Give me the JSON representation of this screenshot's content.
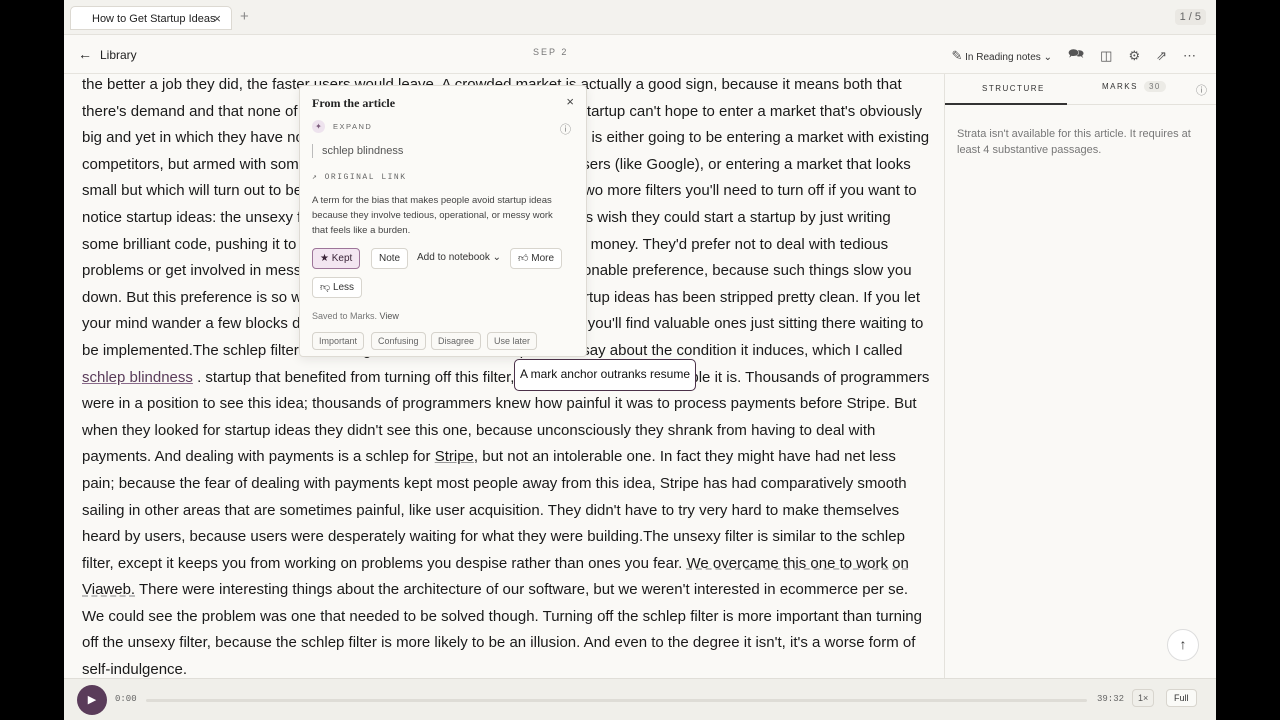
{
  "tabbar": {
    "tab_title": "How to Get Startup Ideas",
    "close_glyph": "×",
    "add_glyph": "+",
    "page_count": "1 / 5"
  },
  "header": {
    "back_label": "Library",
    "date": "SEP 2",
    "reading_notes_label": "In Reading notes"
  },
  "article": {
    "paragraph": [
      {
        "t": "the better a job they did, the faster users would leave. A crowded market is actually a good sign, because it means both that there's demand and that none of the existing solutions are good enough. A startup can't hope to enter a market that's obviously big and yet in which they have no competitors. So any startup that succeeds is either going to be entering a market with existing competitors, but armed with some secret weapon that will get them all the users (like Google), or entering a market that looks small but which will turn out to be big (like Microsoft). [12 ]"
      },
      {
        "t": "Filters",
        "c": "b"
      },
      {
        "t": "There are two more filters you'll need to turn off if you want to notice startup ideas: the unsexy filter and the "
      },
      {
        "t": "schlep filter",
        "c": "ul"
      },
      {
        "t": ". Most programmers wish they could start a startup by just writing some brilliant code, pushing it to a server, and having users pay them lots of money. They'd prefer not to deal with tedious problems or get involved in messy ways with the real world. Which is a reasonable preference, because such things slow you down. But this preference is so widespread that the space of convenient startup ideas has been stripped pretty clean. If you let your mind wander a few blocks down the street to the messy, tedious ideas, you'll find valuable ones just sitting there waiting to be implemented.The schlep filter is so dangerous that I wrote a separate essay about the condition it induces, which I called "
      },
      {
        "t": "schlep blindness",
        "c": "mark"
      },
      {
        "t": " .                                              startup that benefited from turning off this filter, and a pretty striking example it is. Thousands of programmers were in a position to see this idea; thousands of programmers knew how painful it was to process payments before Stripe. But when they looked for startup ideas they didn't see this one, because unconsciously they shrank from having to deal with payments. And dealing with payments is a schlep for "
      },
      {
        "t": "Stripe",
        "c": "ul"
      },
      {
        "t": ", but not an intolerable one. In fact they might have had net less pain; because the fear of dealing with payments kept most people away from this idea, Stripe has had comparatively smooth sailing in other areas that are sometimes painful, like user acquisition. They didn't have to try very hard to make themselves heard by users, because users were desperately waiting for what they were building.The unsexy filter is similar to the schlep filter, except it keeps you from working on problems you despise rather than ones you fear. "
      },
      {
        "t": "We overcame this one to work on Viaweb.",
        "c": "dashed"
      },
      {
        "t": " There were interesting things about the architecture of our software, but we weren't interested in ecommerce per se. We could see the problem was one that needed to be solved though. Turning off the schlep filter is more important than turning off the unsexy filter, because the schlep filter is more likely to be an illusion. And even to the degree it isn't, it's a worse form of self-indulgence."
      }
    ]
  },
  "popover": {
    "title": "From the article",
    "close_glyph": "×",
    "expand_label": "EXPAND",
    "term": "schlep blindness",
    "original_link_label": "↗ ORIGINAL LINK",
    "description": "A term for the bias that makes people avoid startup ideas because they involve tedious, operational, or messy work that feels like a burden.",
    "kept_label": "★ Kept",
    "note_label": "Note",
    "add_notebook_label": "Add to notebook ⌄",
    "more_label": "More",
    "less_label": "Less",
    "saved_text": "Saved to Marks.",
    "view_label": "View",
    "chips": [
      "Important",
      "Confusing",
      "Disagree",
      "Use later"
    ]
  },
  "tooltip": {
    "text": "A mark anchor outranks resume"
  },
  "side": {
    "structure_tab": "STRUCTURE",
    "marks_tab": "MARKS",
    "marks_count": "30",
    "message": "Strata isn't available for this article. It requires at least 4 substantive passages."
  },
  "player": {
    "current_time": "0:00",
    "duration": "39:32",
    "speed": "1×",
    "mode": "Full",
    "progress": 0
  }
}
